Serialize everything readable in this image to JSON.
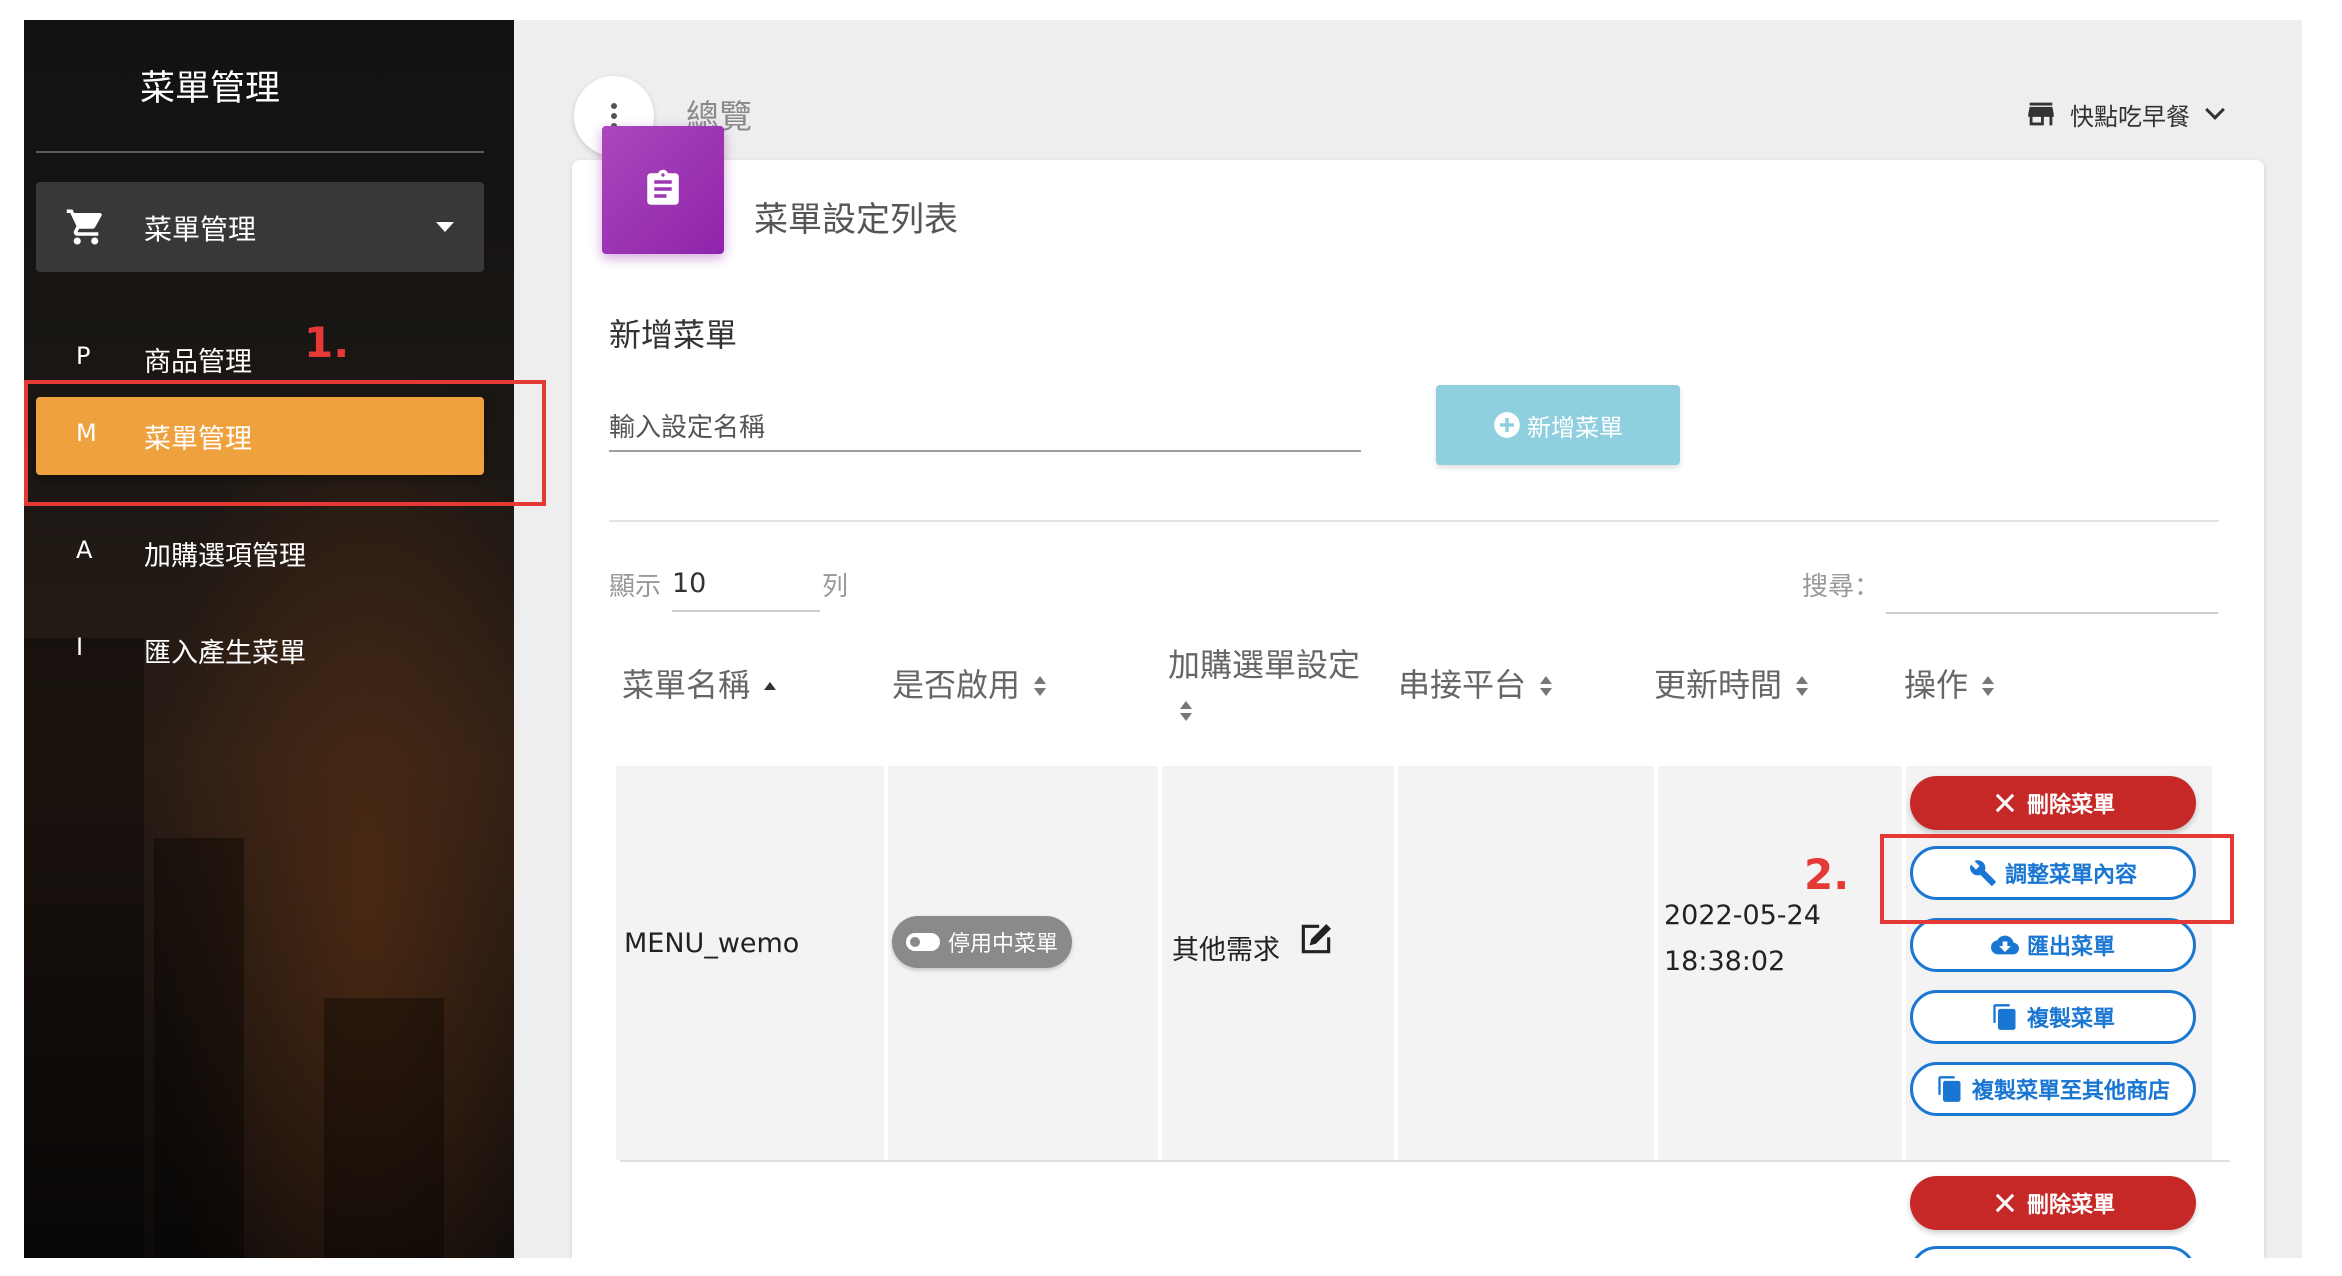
{
  "sidebar": {
    "title": "菜單管理",
    "group": {
      "label": "菜單管理"
    },
    "items": [
      {
        "abbr": "P",
        "label": "商品管理"
      },
      {
        "abbr": "M",
        "label": "菜單管理"
      },
      {
        "abbr": "A",
        "label": "加購選項管理"
      },
      {
        "abbr": "I",
        "label": "匯入產生菜單"
      }
    ]
  },
  "header": {
    "breadcrumb": "總覽",
    "store_name": "快點吃早餐"
  },
  "card": {
    "title": "菜單設定列表",
    "add_heading": "新增菜單",
    "name_placeholder": "輸入設定名稱",
    "add_button": "新增菜單",
    "show_label": "顯示",
    "page_size": "10",
    "show_unit": "列",
    "search_label": "搜尋："
  },
  "table": {
    "headers": [
      "菜單名稱",
      "是否啟用",
      "加購選單設定",
      "串接平台",
      "更新時間",
      "操作"
    ],
    "rows": [
      {
        "name": "MENU_wemo",
        "status": "停用中菜單",
        "addon": "其他需求",
        "platform": "",
        "date": "2022-05-24",
        "time": "18:38:02",
        "actions": [
          "刪除菜單",
          "調整菜單內容",
          "匯出菜單",
          "複製菜單",
          "複製菜單至其他商店"
        ]
      }
    ],
    "next_row_action": "刪除菜單"
  },
  "annotations": {
    "step1": "1.",
    "step2": "2."
  },
  "colors": {
    "active_item": "#efa13e",
    "add_button": "#8fcfe0",
    "danger": "#c62828",
    "outline": "#1976d2",
    "annotation": "#e53935",
    "card_icon": "#9c27b0"
  }
}
